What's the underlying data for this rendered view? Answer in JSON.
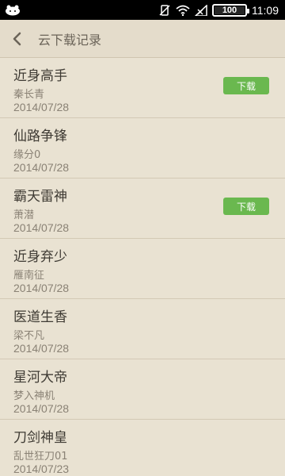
{
  "status_bar": {
    "battery": "100",
    "time": "11:09",
    "icons": [
      "notification-icon",
      "vibrate-icon",
      "wifi-icon",
      "signal-icon"
    ]
  },
  "header": {
    "title": "云下载记录"
  },
  "books": [
    {
      "title": "近身高手",
      "author": "秦长青",
      "date": "2014/07/28",
      "download_label": "下载"
    },
    {
      "title": "仙路争锋",
      "author": "缘分0",
      "date": "2014/07/28"
    },
    {
      "title": "霸天雷神",
      "author": "萧潜",
      "date": "2014/07/28",
      "download_label": "下载"
    },
    {
      "title": "近身弃少",
      "author": "雁南征",
      "date": "2014/07/28"
    },
    {
      "title": "医道生香",
      "author": "梁不凡",
      "date": "2014/07/28"
    },
    {
      "title": "星河大帝",
      "author": "梦入神机",
      "date": "2014/07/28"
    },
    {
      "title": "刀剑神皇",
      "author": "乱世狂刀01",
      "date": "2014/07/23"
    }
  ],
  "colors": {
    "background": "#e9e2d2",
    "download_button": "#6ab84f"
  }
}
